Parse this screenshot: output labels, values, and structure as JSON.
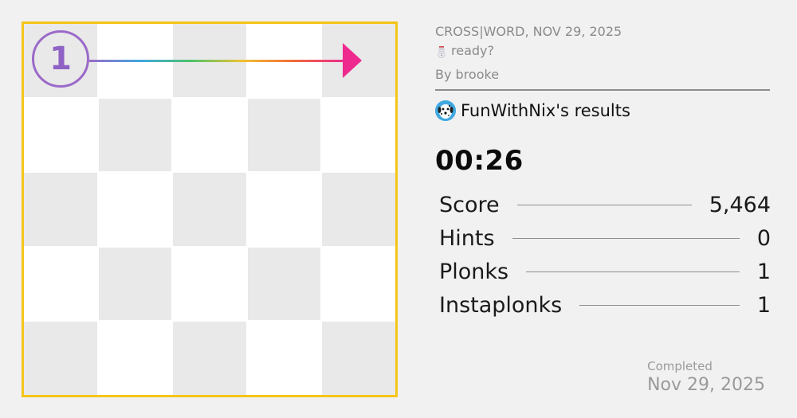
{
  "board": {
    "size": 5,
    "pattern": [
      [
        1,
        0,
        1,
        0,
        1
      ],
      [
        0,
        1,
        0,
        1,
        0
      ],
      [
        1,
        0,
        1,
        0,
        1
      ],
      [
        0,
        1,
        0,
        1,
        0
      ],
      [
        1,
        0,
        1,
        0,
        1
      ]
    ],
    "border_color": "#f5c518",
    "clue_number": "1",
    "arrow_direction": "across",
    "arrow_gradient": [
      "#9b6ac9",
      "#3fa7e0",
      "#4cc36b",
      "#f1c232",
      "#f26b3a",
      "#ee2a8f"
    ]
  },
  "puzzle": {
    "header": "CROSS|WORD, NOV 29, 2025",
    "title": "ready?",
    "author": "By brooke"
  },
  "results": {
    "player_results": "FunWithNix's results",
    "time": "00:26",
    "stats": [
      {
        "label": "Score",
        "value": "5,464"
      },
      {
        "label": "Hints",
        "value": "0"
      },
      {
        "label": "Plonks",
        "value": "1"
      },
      {
        "label": "Instaplonks",
        "value": "1"
      }
    ]
  },
  "completed": {
    "label": "Completed",
    "date": "Nov 29, 2025"
  }
}
